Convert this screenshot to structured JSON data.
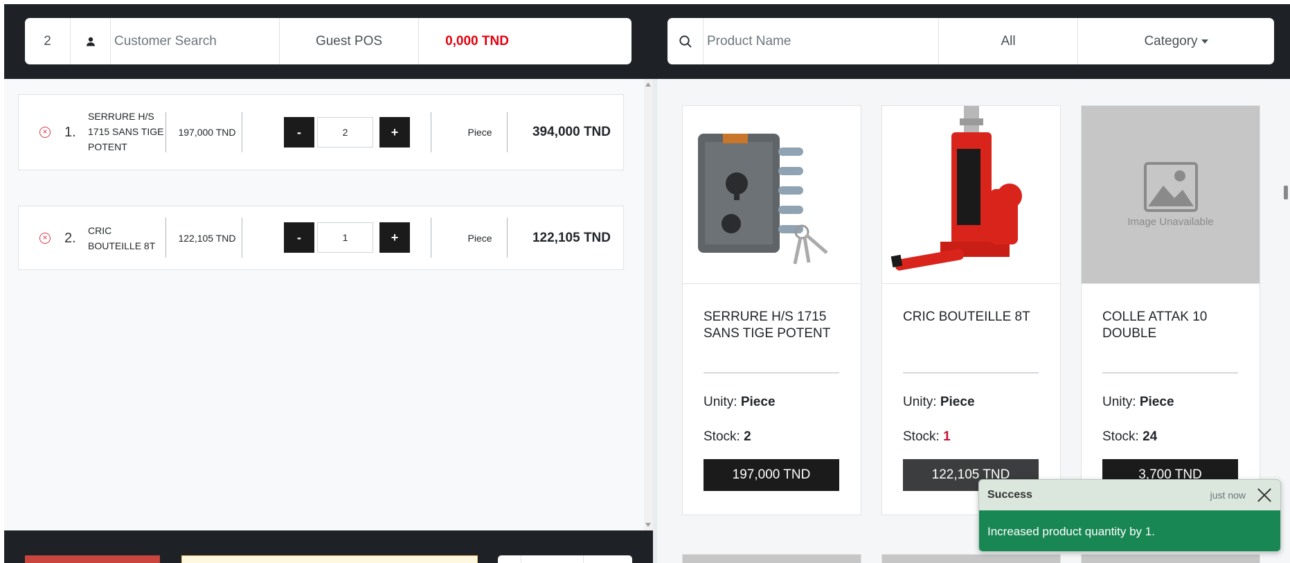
{
  "customer_bar": {
    "count": "2",
    "search_placeholder": "Customer Search",
    "customer": "Guest POS",
    "total": "0,000 TND"
  },
  "product_bar": {
    "search_placeholder": "Product Name",
    "filter": "All",
    "category": "Category"
  },
  "cart": [
    {
      "index": "1.",
      "name": "SERRURE H/S 1715 SANS TIGE POTENT",
      "price": "197,000 TND",
      "qty": "2",
      "unit": "Piece",
      "total": "394,000 TND"
    },
    {
      "index": "2.",
      "name": "CRIC BOUTEILLE 8T",
      "price": "122,105 TND",
      "qty": "1",
      "unit": "Piece",
      "total": "122,105 TND"
    }
  ],
  "qty_buttons": {
    "minus": "-",
    "plus": "+"
  },
  "labels": {
    "unity": "Unity:",
    "stock": "Stock:"
  },
  "products": [
    {
      "name": "SERRURE H/S 1715 SANS TIGE POTENT",
      "unity": "Piece",
      "stock": "2",
      "price": "197,000 TND"
    },
    {
      "name": "CRIC BOUTEILLE 8T",
      "unity": "Piece",
      "stock": "1",
      "price": "122,105 TND"
    },
    {
      "name": "COLLE ATTAK 10 DOUBLE",
      "unity": "Piece",
      "stock": "24",
      "price": "3,700 TND",
      "image_text": "Image Unavailable"
    }
  ],
  "toast": {
    "title": "Success",
    "time": "just now",
    "message": "Increased product quantity by 1."
  },
  "colors": {
    "dark_bar": "#1e2227",
    "total_red": "#e3000f",
    "toast_green": "#198754",
    "remove_red": "#dc3545"
  }
}
